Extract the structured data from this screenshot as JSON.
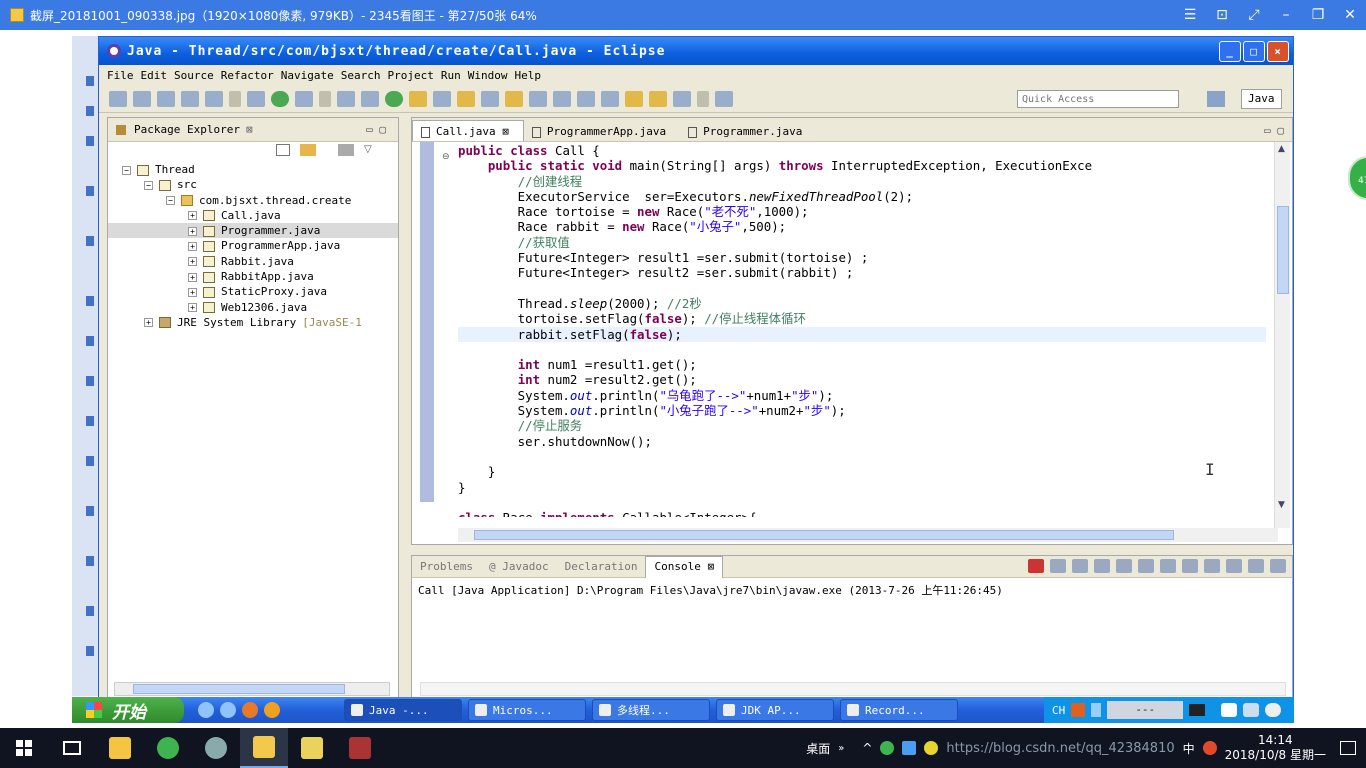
{
  "viewer": {
    "title": "截屏_20181001_090338.jpg（1920×1080像素, 979KB）- 2345看图王 - 第27/50张 64%",
    "controls": [
      "☰",
      "⊡",
      "⤢",
      "–",
      "❐",
      "✕"
    ],
    "bubble_text": "47"
  },
  "eclipse": {
    "title": "Java - Thread/src/com/bjsxt/thread/create/Call.java - Eclipse",
    "menu": [
      "File",
      "Edit",
      "Source",
      "Refactor",
      "Navigate",
      "Search",
      "Project",
      "Run",
      "Window",
      "Help"
    ],
    "quick_access_placeholder": "Quick Access",
    "perspective": "Java"
  },
  "package_explorer": {
    "tab_label": "Package Explorer",
    "tree": [
      {
        "label": "Thread",
        "indent": 0,
        "expander": "−",
        "icon": "project"
      },
      {
        "label": "src",
        "indent": 1,
        "expander": "−",
        "icon": "folder"
      },
      {
        "label": "com.bjsxt.thread.create",
        "indent": 2,
        "expander": "−",
        "icon": "package"
      },
      {
        "label": "Call.java",
        "indent": 3,
        "expander": "+",
        "icon": "java-file"
      },
      {
        "label": "Programmer.java",
        "indent": 3,
        "expander": "+",
        "icon": "java-file",
        "selected": true
      },
      {
        "label": "ProgrammerApp.java",
        "indent": 3,
        "expander": "+",
        "icon": "java-file"
      },
      {
        "label": "Rabbit.java",
        "indent": 3,
        "expander": "+",
        "icon": "java-file"
      },
      {
        "label": "RabbitApp.java",
        "indent": 3,
        "expander": "+",
        "icon": "java-file"
      },
      {
        "label": "StaticProxy.java",
        "indent": 3,
        "expander": "+",
        "icon": "java-file"
      },
      {
        "label": "Web12306.java",
        "indent": 3,
        "expander": "+",
        "icon": "java-file"
      },
      {
        "label": "JRE System Library",
        "suffix": "[JavaSE-1",
        "indent": 1,
        "expander": "+",
        "icon": "library"
      }
    ]
  },
  "editor": {
    "tabs": [
      "Call.java",
      "ProgrammerApp.java",
      "Programmer.java"
    ],
    "active_tab": 0,
    "code": [
      {
        "html": "<span class=\"kw\">public class</span> Call {"
      },
      {
        "html": "    <span class=\"kw\">public static void</span> main(String[] args) <span class=\"kw\">throws</span> InterruptedException, ExecutionExce"
      },
      {
        "html": "        <span class=\"cm\">//创建线程</span>"
      },
      {
        "html": "        ExecutorService  ser=Executors.<span class=\"it\">newFixedThreadPool</span>(2);"
      },
      {
        "html": "        Race tortoise = <span class=\"kw\">new</span> Race(<span class=\"str\">\"老不死\"</span>,1000);"
      },
      {
        "html": "        Race rabbit = <span class=\"kw\">new</span> Race(<span class=\"str\">\"小兔子\"</span>,500);"
      },
      {
        "html": "        <span class=\"cm\">//获取值</span>"
      },
      {
        "html": "        Future&lt;Integer&gt; result1 =ser.submit(tortoise) ;"
      },
      {
        "html": "        Future&lt;Integer&gt; result2 =ser.submit(rabbit) ;"
      },
      {
        "html": ""
      },
      {
        "html": "        Thread.<span class=\"it\">sleep</span>(2000); <span class=\"cm\">//2秒</span>"
      },
      {
        "html": "        tortoise.setFlag(<span class=\"kw\">false</span>); <span class=\"cm\">//停止线程体循环</span>"
      },
      {
        "html": "        rabbit.setFlag(<span class=\"kw\">false</span>);",
        "highlight": true
      },
      {
        "html": ""
      },
      {
        "html": "        <span class=\"kw\">int</span> num1 =result1.get();"
      },
      {
        "html": "        <span class=\"kw\">int</span> num2 =result2.get();"
      },
      {
        "html": "        System.<span class=\"fld\">out</span>.println(<span class=\"str\">\"乌龟跑了--&gt;\"</span>+num1+<span class=\"str\">\"步\"</span>);"
      },
      {
        "html": "        System.<span class=\"fld\">out</span>.println(<span class=\"str\">\"小兔子跑了--&gt;\"</span>+num2+<span class=\"str\">\"步\"</span>);"
      },
      {
        "html": "        <span class=\"cm\">//停止服务</span>"
      },
      {
        "html": "        ser.shutdownNow();"
      },
      {
        "html": ""
      },
      {
        "html": "    }"
      },
      {
        "html": "}"
      },
      {
        "html": ""
      },
      {
        "html": "<span class=\"kw\">class</span> Race <span class=\"kw\">implements</span> Callable&lt;Integer&gt;{"
      }
    ]
  },
  "console": {
    "tabs": [
      "Problems",
      "@ Javadoc",
      "Declaration",
      "Console"
    ],
    "active_tab": 3,
    "launch_line": "Call [Java Application] D:\\Program Files\\Java\\jre7\\bin\\javaw.exe (2013-7-26 上午11:26:45)"
  },
  "xp_taskbar": {
    "start_label": "开始",
    "tasks": [
      "Java -...",
      "Micros...",
      "多线程...",
      "JDK AP...",
      "Record..."
    ],
    "active_task": 0,
    "tray_lang": "CH",
    "tray_box": "---"
  },
  "win10_taskbar": {
    "tray_desktop": "桌面",
    "tray_ime": "中",
    "time": "14:14",
    "date": "2018/10/8 星期一",
    "overlay": "https://blog.csdn.net/qq_42384810"
  }
}
